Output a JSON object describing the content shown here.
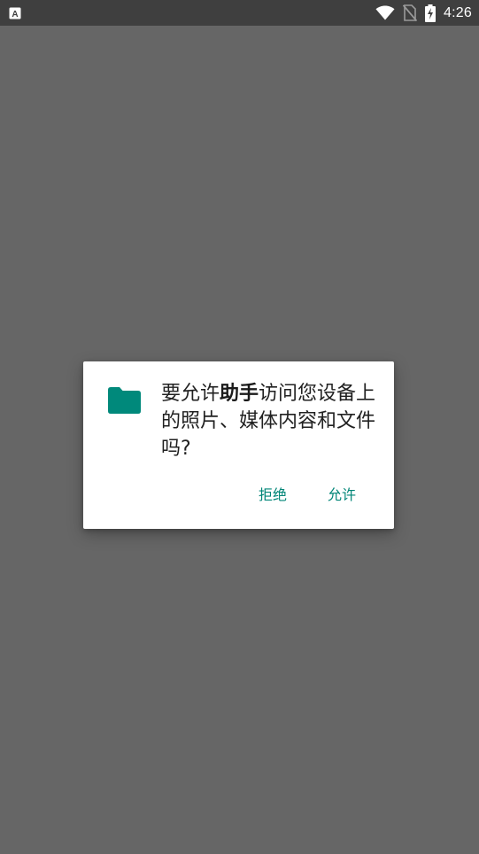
{
  "status_bar": {
    "left_icon": "keyboard-a-icon",
    "icons": [
      "wifi-icon",
      "no-sim-icon",
      "battery-charging-icon"
    ],
    "time": "4:26"
  },
  "dialog": {
    "icon": "folder-icon",
    "message_before": "要允许",
    "app_name": "助手",
    "message_after": "访问您设备上的照片、媒体内容和文件吗?",
    "deny_label": "拒绝",
    "allow_label": "允许",
    "accent_color": "#008577",
    "icon_color": "#00897b"
  },
  "colors": {
    "scrim": "#666666",
    "status_bar": "#3f3f3f",
    "dialog_bg": "#ffffff"
  }
}
